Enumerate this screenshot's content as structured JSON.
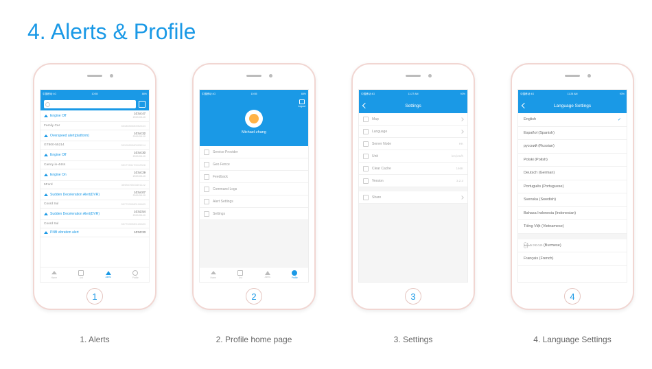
{
  "page_title": "4. Alerts & Profile",
  "phone_digits": [
    "1",
    "2",
    "3",
    "4"
  ],
  "captions": [
    "1. Alerts",
    "2. Profile home page",
    "3. Settings",
    "4. Language Settings"
  ],
  "statusbar": {
    "carrier": "中国移动 4G",
    "time1": "10:55",
    "time3": "11:27 AM",
    "time4": "11:28 AM",
    "batt": "88%",
    "batt3": "93%",
    "batt4": "93%"
  },
  "search_placeholder": "",
  "alerts": [
    {
      "title": "Engine Off",
      "time": "10:54:47",
      "date": "2019-05-10",
      "dev": "Family Car",
      "devid": "3518080080052434"
    },
    {
      "title": "Overspeed alert(platform)",
      "time": "10:54:32",
      "date": "2019-05-10",
      "dev": "GT800-55214",
      "devid": "3510080080005214"
    },
    {
      "title": "Engine Off",
      "time": "10:54:30",
      "date": "2019-05-10",
      "dev": "Camry in-4444",
      "devid": "3517783170012528"
    },
    {
      "title": "Engine On",
      "time": "10:54:29",
      "date": "2019-05-10",
      "dev": "5Ford",
      "devid": "3598570803491122"
    },
    {
      "title": "Sudden Deceleration Alert(DVR)",
      "time": "10:54:07",
      "date": "2019-05-10",
      "dev": "Coord Sul",
      "devid": "3577330980126483"
    },
    {
      "title": "Sudden Deceleration Alert(DVR)",
      "time": "10:53:54",
      "date": "2019-05-10",
      "dev": "Coord Sul",
      "devid": "3577330980126483"
    },
    {
      "title": "PNB vibration alert",
      "time": "10:53:33",
      "date": "",
      "dev": "",
      "devid": ""
    }
  ],
  "tabs": [
    "Home",
    "List",
    "Alerts",
    "Profile"
  ],
  "profile": {
    "logout": "Logout",
    "name": "Michael-zhang",
    "items": [
      "Service Provider",
      "Geo Fence",
      "Feedback",
      "Command Logs",
      "Alert Settings",
      "Settings"
    ]
  },
  "settings": {
    "title": "Settings",
    "rows": [
      {
        "label": "Map",
        "value": ""
      },
      {
        "label": "Language",
        "value": ""
      },
      {
        "label": "Server Node",
        "value": "HK"
      },
      {
        "label": "Unit",
        "value": "km,km/h"
      },
      {
        "label": "Clear Cache",
        "value": "166K"
      },
      {
        "label": "Version",
        "value": "3.2.3"
      },
      {
        "label": "Share",
        "value": ""
      }
    ]
  },
  "language": {
    "title": "Language Settings",
    "rows": [
      "English",
      "Español (Spanish)",
      "русский (Russian)",
      "Polski (Polish)",
      "Deutsch (German)",
      "Português (Portuguese)",
      "Svenska (Swedish)",
      "Bahasa Indonesia (Indonesian)",
      "Tiếng Việt (Vietnamese)",
      "မြန်မာဘာသာ (Burmese)",
      "Français (French)"
    ],
    "selected": 0
  }
}
